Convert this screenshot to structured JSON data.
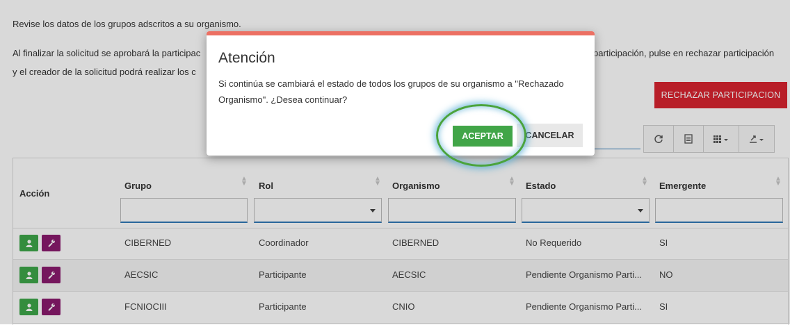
{
  "intro": {
    "line1": "Revise los datos de los grupos adscritos a su organismo.",
    "line2_left": "Al finalizar la solicitud se aprobará la participac",
    "line2_right": "participación, pulse en rechazar participación",
    "line3_left": "y el creador de la solicitud podrá realizar los c"
  },
  "reject_button": "RECHAZAR PARTICIPACION",
  "toolbar": {
    "icons": [
      "refresh-icon",
      "list-icon",
      "columns-icon",
      "export-icon"
    ]
  },
  "table": {
    "headers": {
      "accion": "Acción",
      "grupo": "Grupo",
      "rol": "Rol",
      "organismo": "Organismo",
      "estado": "Estado",
      "emergente": "Emergente"
    },
    "rows": [
      {
        "grupo": "CIBERNED",
        "rol": "Coordinador",
        "organismo": "CIBERNED",
        "estado": "No Requerido",
        "emergente": "SI"
      },
      {
        "grupo": "AECSIC",
        "rol": "Participante",
        "organismo": "AECSIC",
        "estado": "Pendiente Organismo Parti...",
        "emergente": "NO"
      },
      {
        "grupo": "FCNIOCIII",
        "rol": "Participante",
        "organismo": "CNIO",
        "estado": "Pendiente Organismo Parti...",
        "emergente": "SI"
      }
    ]
  },
  "modal": {
    "title": "Atención",
    "body": "Si continúa se cambiará el estado de todos los grupos de su organismo a \"Rechazado Organismo\". ¿Desea continuar?",
    "accept": "ACEPTAR",
    "cancel": "CANCELAR"
  },
  "colors": {
    "danger": "#d9242f",
    "success": "#41a548",
    "purple": "#8a1a6e",
    "modal_bar": "#ec7063",
    "highlight": "#4aa33d"
  }
}
